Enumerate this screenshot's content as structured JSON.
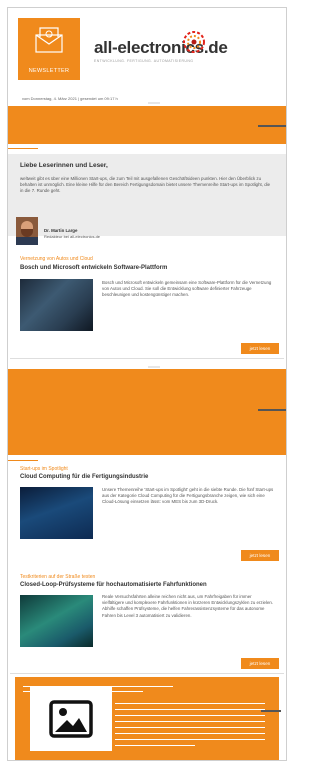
{
  "header": {
    "newsletter_label": "NEWSLETTER",
    "brand_name": "all-electronics.de",
    "brand_tagline": "ENTWICKLUNG. FERTIGUNG. AUTOMATISIERUNG",
    "date_line": "vom Donnerstag, 4. März 2021 | gesendet um 09:17 h",
    "accent_color": "#f08a1c"
  },
  "intro": {
    "greeting": "Liebe Leserinnen und Leser,",
    "text": "weltweit gibt es über eine Millionen Start-ups, die zum Teil mit ausgefallenen Geschäftsideen punkten. Hier den Überblick zu behalten ist unmöglich. Eine kleine Hilfe für den Bereich Fertigungsdomain bietet unsere Themenreihe Start-ups im Spotlight, die in die 7. Runde geht.",
    "author_name": "Dr. Martin Large",
    "author_role": "Redakteur bei all-electronics.de"
  },
  "articles": [
    {
      "kicker": "Vernetzung von Autos und Cloud",
      "title": "Bosch und Microsoft entwickeln Software-Plattform",
      "text": "Bosch und Microsoft entwickeln gemeinsam eine Software-Plattform für die Vernetzung von Autos und Cloud. Sie soll die Entwicklung software definierter Fahrzeuge beschleunigen und kostengünstiger machen.",
      "more_label": "jetzt lesen"
    },
    {
      "kicker": "Start-ups im Spotlight",
      "title": "Cloud Computing für die Fertigungsindustrie",
      "text": "Unsere Themenreihe 'Start-ups im Spotlight' geht in die siebte Runde. Die fünf Start-ups aus der Kategorie Cloud Computing für die Fertigungsbranche zeigen, wie sich eine Cloud-Lösung einsetzen lässt: vom MES bis zum 3D-Druck.",
      "more_label": "jetzt lesen"
    },
    {
      "kicker": "Testkriterien auf der Straße testen",
      "title": "Closed-Loop-Prüfsysteme für hochautomatisierte Fahrfunktionen",
      "text": "Reale Versuchsfahrten alleine reichen nicht aus, um Fahrfreigaben für immer vielfältigere und komplexere Fahrfunktionen in kürzeren Entwicklungszyklen zu erzielen. Abhilfe schaffen Prüfsysteme, die helfen Fahrerassistenzsysteme für das autonome Fahren bis Level 3 automatisiert zu validieren.",
      "more_label": "jetzt lesen"
    }
  ],
  "icons": {
    "envelope": "envelope-at-icon",
    "brand_logo": "brand-swirl-icon",
    "placeholder": "image-placeholder-icon"
  }
}
